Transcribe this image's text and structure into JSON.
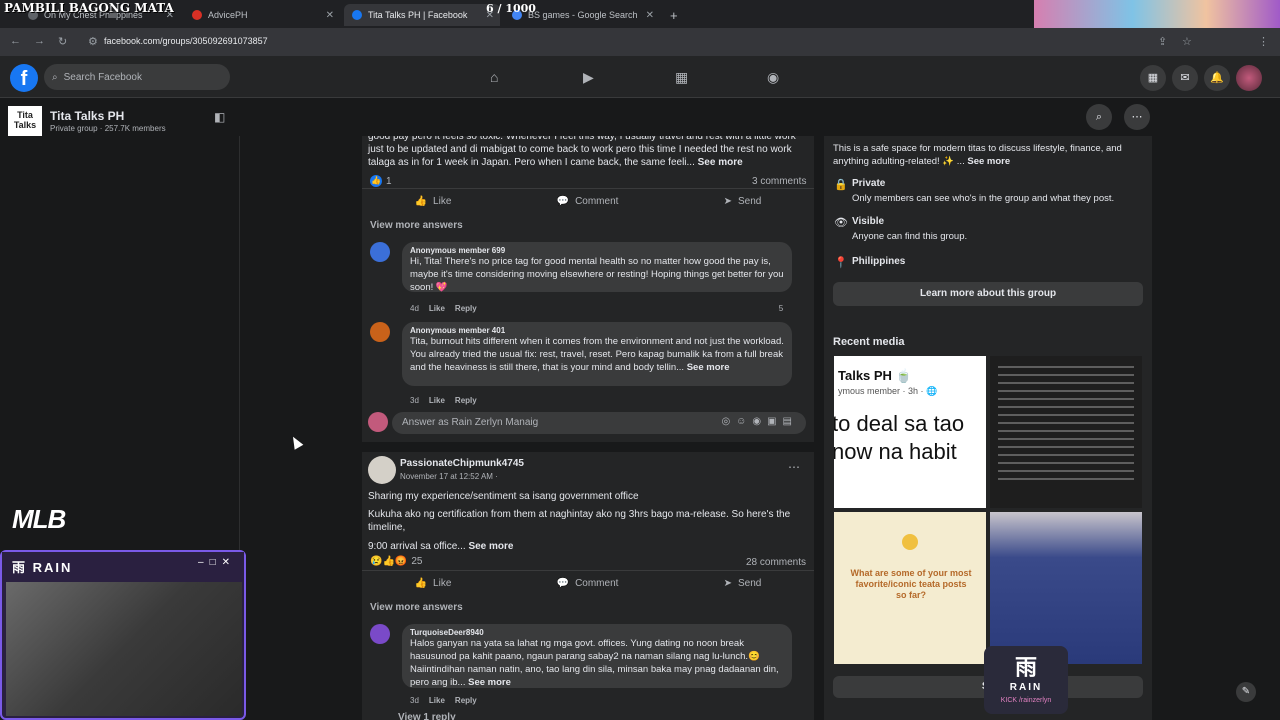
{
  "browser": {
    "overlay_title": "PAMBILI BAGONG MATA",
    "counter": "6 / 1000",
    "tabs": [
      {
        "label": "On My Chest Philippines"
      },
      {
        "label": "AdvicePH"
      },
      {
        "label": "Tita Talks PH | Facebook"
      },
      {
        "label": "BS games - Google Search"
      }
    ],
    "url": "facebook.com/groups/305092691073857"
  },
  "fbnav": {
    "search_placeholder": "Search Facebook"
  },
  "group": {
    "name": "Tita Talks PH",
    "meta": "Private group · 257.7K members",
    "logo_text": "Tita Talks"
  },
  "feed": {
    "post1": {
      "tail_text": "good pay pero it feels so toxic. Whenever I feel this way, I usually travel and rest with a little work just to be updated and di mabigat to come back to work pero this time I needed the rest no work talaga as in for 1 week in Japan. Pero when I came back, the same feeli...",
      "see_more": "See more",
      "reactions": "1",
      "comments_count": "3 comments",
      "view_more": "View more answers",
      "comments": [
        {
          "name": "Anonymous member 699",
          "body": "Hi, Tita! There's no price tag for good mental health so no matter how good the pay is, maybe it's time considering moving elsewhere or resting! Hoping things get better for you soon! 💖",
          "time": "4d",
          "likes": "5"
        },
        {
          "name": "Anonymous member 401",
          "body": "Tita, burnout hits different when it comes from the environment and not just the workload. You already tried the usual fix: rest, travel, reset. Pero kapag bumalik ka from a full break and the heaviness is still there, that is your mind and body tellin...",
          "see_more": "See more",
          "time": "3d"
        }
      ],
      "answer_placeholder": "Answer as Rain Zerlyn Manaig"
    },
    "post2": {
      "author": "PassionateChipmunk4745",
      "timestamp": "November 17 at 12:52 AM · ",
      "line1": "Sharing my experience/sentiment sa isang government office",
      "line2": "Kukuha ako ng certification from them at naghintay ako ng 3hrs bago ma-release. So here's the timeline,",
      "line3": "9:00 arrival sa office...",
      "see_more": "See more",
      "reactions": "25",
      "comments_count": "28 comments",
      "view_more": "View more answers",
      "comments": [
        {
          "name": "TurquoiseDeer8940",
          "body": "Halos ganyan na yata sa lahat ng mga govt. offices. Yung dating no noon break hasusunod pa kahit paano, ngaun parang sabay2 na naman silang nag lu-lunch.😊 Naiintindihan naman natin, ano, tao lang din sila, minsan baka may pnag dadaanan din, pero ang ib...",
          "see_more": "See more",
          "time": "3d"
        }
      ],
      "view_reply": "View 1 reply"
    },
    "actions": {
      "like": "Like",
      "comment": "Comment",
      "send": "Send",
      "reply": "Reply"
    }
  },
  "about": {
    "desc": "This is a safe space for modern titas to discuss lifestyle, finance, and anything adulting-related! ✨ ...",
    "see_more": "See more",
    "private_title": "Private",
    "private_sub": "Only members can see who's in the group and what they post.",
    "visible_title": "Visible",
    "visible_sub": "Anyone can find this group.",
    "location": "Philippines",
    "learn_more": "Learn more about this group",
    "recent_media": "Recent media",
    "media1_line1": "Talks PH 🍵",
    "media1_line2": "ymous member · 3h · 🌐",
    "media1_big": "to deal sa tao now na habit",
    "media3_text": "What are some of your most favorite/iconic teata posts so far?",
    "see_all": "Se"
  },
  "overlay": {
    "mlb": "MLB",
    "cam_label": "雨 RAIN",
    "badge_glyph": "雨",
    "badge_label": "RAIN",
    "kick": "KICK /rainzerlyn"
  }
}
